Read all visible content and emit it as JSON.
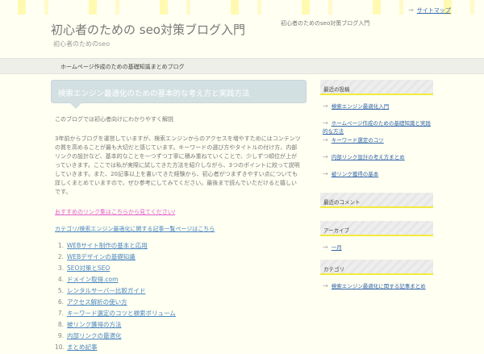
{
  "header": {
    "top_link": "サイトマップ",
    "site_title": "初心者のための seo対策ブログ入門",
    "description": "初心者のためのseo対策ブログ入門",
    "tagline": "初心者のためのseo"
  },
  "nav": {
    "item": "ホームページ作成のための基礎知識まとめブログ"
  },
  "post": {
    "title": "検索エンジン最適化のための基本的な考え方と実践方法",
    "meta": "このブログでは初心者向けにわかりやすく解説",
    "body": "3年前からブログを運営していますが、検索エンジンからのアクセスを増やすためにはコンテンツの質を高めることが最も大切だと感じています。キーワードの選び方やタイトルの付け方、内部リンクの設計など、基本的なことを一つずつ丁寧に積み重ねていくことで、少しずつ順位が上がっていきます。ここでは私が実際に試してきた方法を紹介しながら、3つのポイントに絞って説明していきます。また、20記事以上を書いてきた経験から、初心者がつまずきやすい点についても詳しくまとめていますので、ぜひ参考にしてみてください。最後まで読んでいただけると嬉しいです。",
    "pink_link": "おすすめのリンク集はこちらから見てください/",
    "blue_link": "カテゴリ/検索エンジン最適化に関する記事一覧ページはこちら",
    "list": [
      {
        "n": "1.",
        "t": "WEBサイト制作の基本と応用"
      },
      {
        "n": "2.",
        "t": "WEBデザインの基礎知識"
      },
      {
        "n": "3.",
        "t": "SEO対策とSEO"
      },
      {
        "n": "4.",
        "t": "ドメイン取得.com"
      },
      {
        "n": "5.",
        "t": "レンタルサーバー比較ガイド"
      },
      {
        "n": "6.",
        "t": "アクセス解析の使い方"
      },
      {
        "n": "7.",
        "t": "キーワード選定のコツと検索ボリューム"
      },
      {
        "n": "8.",
        "t": "被リンク獲得の方法"
      },
      {
        "n": "9.",
        "t": "内部リンクの最適化"
      },
      {
        "n": "10.",
        "t": "まとめ記事"
      }
    ]
  },
  "sidebar": [
    {
      "heading": "最近の投稿",
      "links": [
        "検索エンジン最適化入門",
        "ホームページ作成のための基礎知識と実践的な方法",
        "キーワード選定のコツ",
        "内部リンク設計の考え方まとめ",
        "被リンク獲得の基本"
      ]
    },
    {
      "heading": "最近のコメント",
      "links": []
    },
    {
      "heading": "アーカイブ",
      "links": [
        "一月"
      ]
    },
    {
      "heading": "カテゴリ",
      "links": [
        "検索エンジン最適化に関する記事まとめ"
      ]
    }
  ]
}
